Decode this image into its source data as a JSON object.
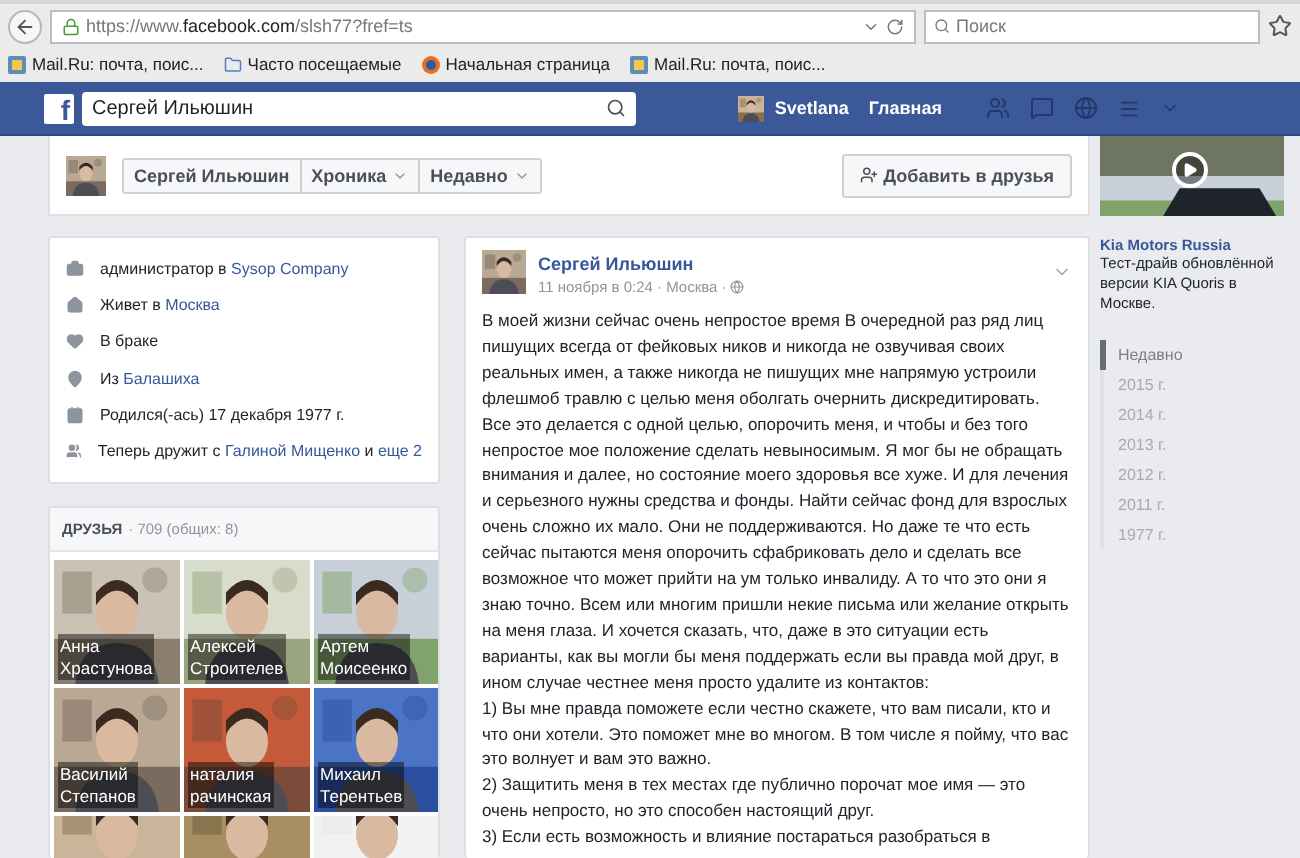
{
  "browser": {
    "url_host": "https://www.",
    "url_domain": "facebook.com",
    "url_path": "/slsh77?fref=ts",
    "search_placeholder": "Поиск",
    "bookmarks": [
      {
        "label": "Mail.Ru: почта, поис...",
        "kind": "mail"
      },
      {
        "label": "Часто посещаемые",
        "kind": "folder"
      },
      {
        "label": "Начальная страница",
        "kind": "browser"
      },
      {
        "label": "Mail.Ru: почта, поис...",
        "kind": "mail"
      }
    ]
  },
  "facebook_bar": {
    "logo": "f",
    "search_value": "Сергей Ильюшин",
    "user": "Svetlana",
    "home": "Главная"
  },
  "profile_header": {
    "tabs": [
      {
        "label": "Сергей Ильюшин",
        "dropdown": false
      },
      {
        "label": "Хроника",
        "dropdown": true
      },
      {
        "label": "Недавно",
        "dropdown": true
      }
    ],
    "add_friend": "Добавить в друзья"
  },
  "about": [
    {
      "kind": "work",
      "parts": [
        {
          "text": "администратор в ",
          "link": false
        },
        {
          "text": "Sysop Company",
          "link": true
        }
      ]
    },
    {
      "kind": "home",
      "parts": [
        {
          "text": "Живет в ",
          "link": false
        },
        {
          "text": "Москва",
          "link": true
        }
      ]
    },
    {
      "kind": "relationship",
      "parts": [
        {
          "text": "В браке",
          "link": false
        }
      ]
    },
    {
      "kind": "place",
      "parts": [
        {
          "text": "Из ",
          "link": false
        },
        {
          "text": "Балашиха",
          "link": true
        }
      ]
    },
    {
      "kind": "birthday",
      "parts": [
        {
          "text": "Родился(-ась) 17 декабря 1977 г.",
          "link": false
        }
      ]
    },
    {
      "kind": "friends",
      "parts": [
        {
          "text": "Теперь дружит с ",
          "link": false
        },
        {
          "text": "Галиной Мищенко",
          "link": true
        },
        {
          "text": " и ",
          "link": false
        },
        {
          "text": "еще 2",
          "link": true
        }
      ]
    }
  ],
  "friends": {
    "title": "ДРУЗЬЯ",
    "count": "· 709 (общих: 8)",
    "items": [
      {
        "first": "Анна",
        "last": "Храстунова"
      },
      {
        "first": "Алексей",
        "last": "Строителев"
      },
      {
        "first": "Артем",
        "last": "Моисеенко"
      },
      {
        "first": "Василий",
        "last": "Степанов"
      },
      {
        "first": "наталия",
        "last": "рачинская"
      },
      {
        "first": "Михаил",
        "last": "Терентьев"
      },
      {
        "kind": "picture"
      },
      {
        "kind": "picture"
      },
      {
        "kind": "picture"
      }
    ]
  },
  "post": {
    "author": "Сергей Ильюшин",
    "meta": "11 ноября в 0:24 · Москва ·",
    "paragraphs": [
      "В моей жизни сейчас очень непростое время В очередной раз ряд лиц пишущих всегда от фейковых ников и никогда не озвучивая своих реальных имен, а также никогда не пишущих мне напрямую устроили флешмоб травлю с целью меня оболгать очернить дискредитировать. Все это делается с одной целью, опорочить меня, и чтобы и без того непростое мое положение сделать невыносимым. Я мог бы не обращать внимания и далее, но состояние моего здоровья все хуже. И для лечения и серьезного нужны средства и фонды. Найти сейчас фонд для взрослых очень сложно их мало. Они не поддерживаются. Но даже те что есть сейчас пытаются меня опорочить сфабриковать дело и сделать все возможное что может прийти на ум только инвалиду. А то что это они я знаю точно. Всем или многим пришли некие письма или желание открыть на меня глаза. И хочется сказать, что, даже в это ситуации есть варианты, как вы могли бы меня поддержать если вы правда мой друг, в ином случае честнее меня просто удалите из контактов:",
      "1) Вы мне правда поможете если честно скажете, что вам писали, кто и что они хотели. Это поможет мне во многом. В том числе я пойму, что вас это волнует и вам это важно.",
      "2) Защитить меня в тех местах где публично порочат мое имя — это очень непросто, но это способен настоящий друг.",
      "3) Если есть возможность и влияние постараться разобраться в"
    ]
  },
  "ad": {
    "advertiser": "Kia Motors Russia",
    "text": "Тест-драйв обновлённой версии KIA Quoris в Москве."
  },
  "timeline": [
    {
      "label": "Недавно",
      "selected": true
    },
    {
      "label": "2015 г.",
      "selected": false
    },
    {
      "label": "2014 г.",
      "selected": false
    },
    {
      "label": "2013 г.",
      "selected": false
    },
    {
      "label": "2012 г.",
      "selected": false
    },
    {
      "label": "2011 г.",
      "selected": false
    },
    {
      "label": "1977 г.",
      "selected": false
    }
  ]
}
